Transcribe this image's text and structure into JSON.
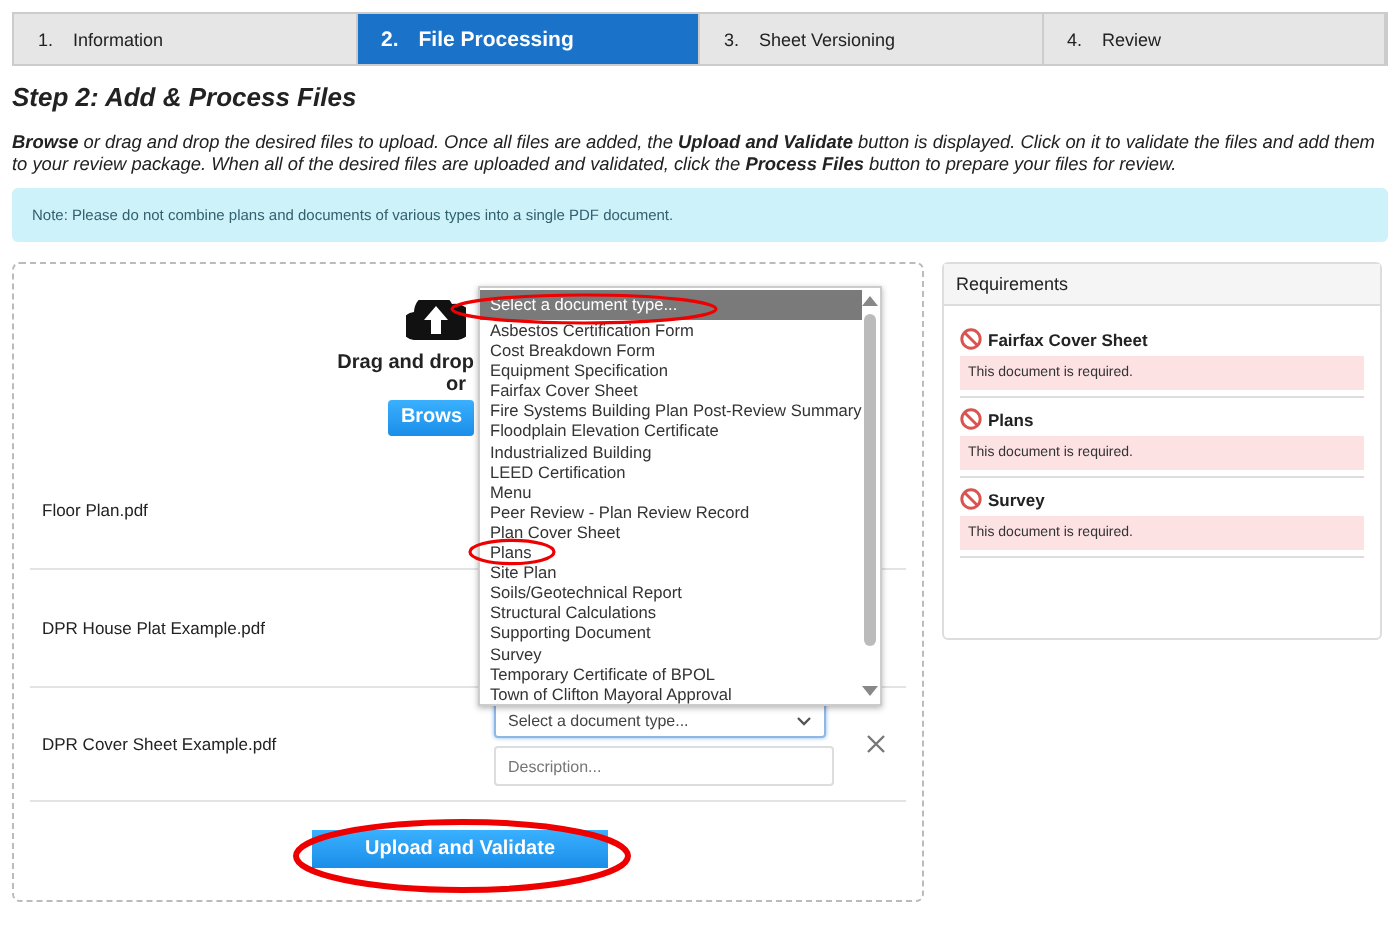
{
  "steps": [
    {
      "number": "1.",
      "label": "Information",
      "selected": false
    },
    {
      "number": "2.",
      "label": "File Processing",
      "selected": true
    },
    {
      "number": "3.",
      "label": "Sheet Versioning",
      "selected": false
    },
    {
      "number": "4.",
      "label": "Review",
      "selected": false
    }
  ],
  "heading": "Step 2: Add & Process Files",
  "instructions": "**Browse** or drag and drop the desired files to upload. Once all files are added, the **Upload and Validate** button is displayed. Click on it to validate the files and add them to your review package. When all of the desired files are uploaded and validated, click the **Process Files** button to prepare your files for review.",
  "note": "Note: Please do not combine plans and documents of various types into a single PDF document.",
  "upload": {
    "drag_text": "Drag and drop",
    "or_text": "or",
    "browse_button": "Brows"
  },
  "files": [
    {
      "name": "Floor Plan.pdf",
      "kind": "covered"
    },
    {
      "name": "DPR House Plat Example.pdf",
      "kind": "covered"
    },
    {
      "name": "DPR Cover Sheet Example.pdf",
      "kind": "editable",
      "type_placeholder": "Select a document type...",
      "description_placeholder": "Description..."
    }
  ],
  "dropdown": {
    "options": [
      {
        "label": "Select a document type...",
        "selected": true
      },
      {
        "label": "Asbestos Certification Form",
        "selected": false
      },
      {
        "label": "Cost Breakdown Form",
        "selected": false
      },
      {
        "label": "Equipment Specification",
        "selected": false
      },
      {
        "label": "Fairfax Cover Sheet",
        "selected": false
      },
      {
        "label": "Fire Systems Building Plan Post-Review Summary",
        "selected": false
      },
      {
        "label": "Floodplain Elevation Certificate",
        "selected": false
      },
      {
        "label": "Industrialized Building",
        "selected": false
      },
      {
        "label": "LEED Certification",
        "selected": false
      },
      {
        "label": "Menu",
        "selected": false
      },
      {
        "label": "Peer Review - Plan Review Record",
        "selected": false
      },
      {
        "label": "Plan Cover Sheet",
        "selected": false
      },
      {
        "label": "Plans",
        "selected": false
      },
      {
        "label": "Site Plan",
        "selected": false
      },
      {
        "label": "Soils/Geotechnical Report",
        "selected": false
      },
      {
        "label": "Structural Calculations",
        "selected": false
      },
      {
        "label": "Supporting Document",
        "selected": false
      },
      {
        "label": "Survey",
        "selected": false
      },
      {
        "label": "Temporary Certificate of BPOL",
        "selected": false
      },
      {
        "label": "Town of Clifton Mayoral Approval",
        "selected": false
      }
    ]
  },
  "upload_button": "Upload and Validate",
  "requirements": {
    "title": "Requirements",
    "items": [
      {
        "name": "Fairfax Cover Sheet",
        "message": "This document is required."
      },
      {
        "name": "Plans",
        "message": "This document is required."
      },
      {
        "name": "Survey",
        "message": "This document is required."
      }
    ]
  }
}
